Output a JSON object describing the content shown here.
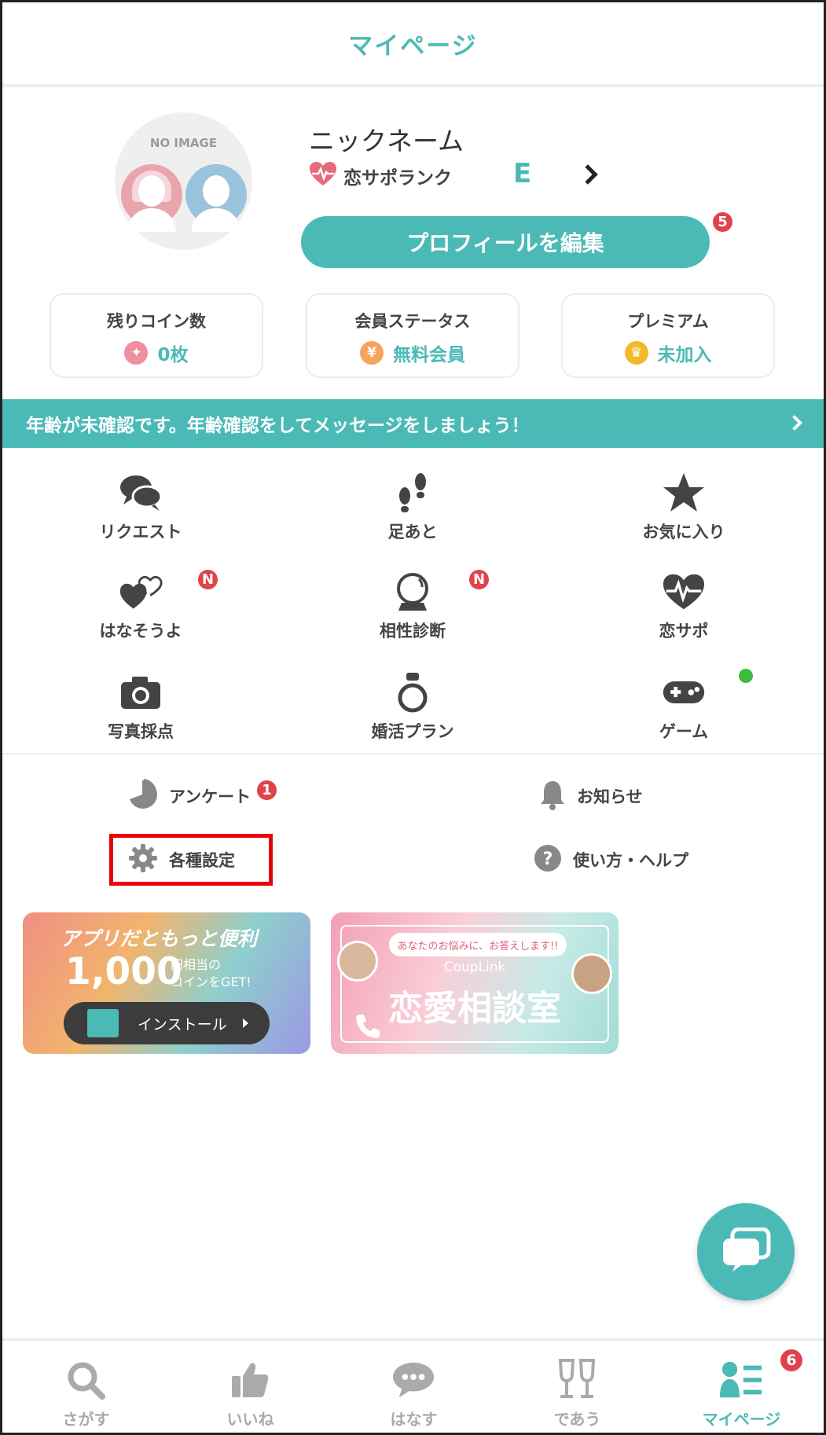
{
  "header": {
    "title": "マイページ"
  },
  "profile": {
    "no_image": "NO IMAGE",
    "nickname": "ニックネーム",
    "rank_label": "恋サポランク",
    "rank_value": "E",
    "edit_button": "プロフィールを編集",
    "edit_badge": "5"
  },
  "stats": [
    {
      "title": "残りコイン数",
      "value": "0枚",
      "icon": "coin-icon",
      "icon_color": "#ef8fa0"
    },
    {
      "title": "会員ステータス",
      "value": "無料会員",
      "icon": "yen-icon",
      "icon_color": "#f5a55a"
    },
    {
      "title": "プレミアム",
      "value": "未加入",
      "icon": "premium-icon",
      "icon_color": "#f3b92d"
    }
  ],
  "age_banner": "年齢が未確認です。年齢確認をしてメッセージをしましょう！",
  "grid": [
    {
      "label": "リクエスト",
      "icon": "speech-bubbles-icon"
    },
    {
      "label": "足あと",
      "icon": "footprints-icon"
    },
    {
      "label": "お気に入り",
      "icon": "star-icon"
    },
    {
      "label": "はなそうよ",
      "icon": "hearts-icon",
      "badge": "N"
    },
    {
      "label": "相性診断",
      "icon": "crystal-ball-icon",
      "badge": "N"
    },
    {
      "label": "恋サポ",
      "icon": "heart-pulse-icon"
    },
    {
      "label": "写真採点",
      "icon": "camera-icon"
    },
    {
      "label": "婚活プラン",
      "icon": "ring-icon"
    },
    {
      "label": "ゲーム",
      "icon": "gamepad-icon"
    }
  ],
  "links": {
    "survey": {
      "label": "アンケート",
      "badge": "1"
    },
    "notice": {
      "label": "お知らせ"
    },
    "settings": {
      "label": "各種設定"
    },
    "help": {
      "label": "使い方・ヘルプ"
    }
  },
  "promos": {
    "app": {
      "title": "アプリだともっと便利",
      "amount": "1,000",
      "sub1": "円相当の",
      "sub2": "コインをGET!",
      "button": "インストール"
    },
    "consult": {
      "pill": "あなたのお悩みに、お答えします!!",
      "brand": "CoupLink",
      "title": "恋愛相談室"
    }
  },
  "tabs": [
    {
      "label": "さがす",
      "icon": "search-icon"
    },
    {
      "label": "いいね",
      "icon": "thumbs-up-icon"
    },
    {
      "label": "はなす",
      "icon": "chat-icon"
    },
    {
      "label": "であう",
      "icon": "glasses-icon"
    },
    {
      "label": "マイページ",
      "icon": "mypage-icon",
      "badge": "6",
      "active": true
    }
  ],
  "colors": {
    "accent": "#4bbab7",
    "badge": "#e0434b",
    "highlight": "#e8000b",
    "online": "#3fba3f"
  }
}
